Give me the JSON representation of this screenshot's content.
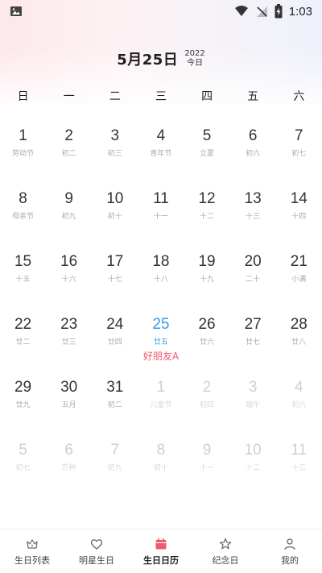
{
  "status_bar": {
    "time": "1:03"
  },
  "header": {
    "date": "5月25日",
    "year": "2022",
    "today_label": "今日"
  },
  "weekdays": [
    "日",
    "一",
    "二",
    "三",
    "四",
    "五",
    "六"
  ],
  "calendar": {
    "days": [
      {
        "num": "1",
        "lunar": "劳动节",
        "other": false
      },
      {
        "num": "2",
        "lunar": "初二",
        "other": false
      },
      {
        "num": "3",
        "lunar": "初三",
        "other": false
      },
      {
        "num": "4",
        "lunar": "青年节",
        "other": false
      },
      {
        "num": "5",
        "lunar": "立夏",
        "other": false
      },
      {
        "num": "6",
        "lunar": "初六",
        "other": false
      },
      {
        "num": "7",
        "lunar": "初七",
        "other": false
      },
      {
        "num": "8",
        "lunar": "母亲节",
        "other": false
      },
      {
        "num": "9",
        "lunar": "初九",
        "other": false
      },
      {
        "num": "10",
        "lunar": "初十",
        "other": false
      },
      {
        "num": "11",
        "lunar": "十一",
        "other": false
      },
      {
        "num": "12",
        "lunar": "十二",
        "other": false
      },
      {
        "num": "13",
        "lunar": "十三",
        "other": false
      },
      {
        "num": "14",
        "lunar": "十四",
        "other": false
      },
      {
        "num": "15",
        "lunar": "十五",
        "other": false
      },
      {
        "num": "16",
        "lunar": "十六",
        "other": false
      },
      {
        "num": "17",
        "lunar": "十七",
        "other": false
      },
      {
        "num": "18",
        "lunar": "十八",
        "other": false
      },
      {
        "num": "19",
        "lunar": "十九",
        "other": false
      },
      {
        "num": "20",
        "lunar": "二十",
        "other": false
      },
      {
        "num": "21",
        "lunar": "小满",
        "other": false
      },
      {
        "num": "22",
        "lunar": "廿二",
        "other": false
      },
      {
        "num": "23",
        "lunar": "廿三",
        "other": false
      },
      {
        "num": "24",
        "lunar": "廿四",
        "other": false
      },
      {
        "num": "25",
        "lunar": "廿五",
        "other": false,
        "today": true,
        "event": "好朋友A"
      },
      {
        "num": "26",
        "lunar": "廿六",
        "other": false
      },
      {
        "num": "27",
        "lunar": "廿七",
        "other": false
      },
      {
        "num": "28",
        "lunar": "廿八",
        "other": false
      },
      {
        "num": "29",
        "lunar": "廿九",
        "other": false
      },
      {
        "num": "30",
        "lunar": "五月",
        "other": false
      },
      {
        "num": "31",
        "lunar": "初二",
        "other": false
      },
      {
        "num": "1",
        "lunar": "儿童节",
        "other": true
      },
      {
        "num": "2",
        "lunar": "初四",
        "other": true
      },
      {
        "num": "3",
        "lunar": "端午",
        "other": true
      },
      {
        "num": "4",
        "lunar": "初六",
        "other": true
      },
      {
        "num": "5",
        "lunar": "初七",
        "other": true
      },
      {
        "num": "6",
        "lunar": "芒种",
        "other": true
      },
      {
        "num": "7",
        "lunar": "初九",
        "other": true
      },
      {
        "num": "8",
        "lunar": "初十",
        "other": true
      },
      {
        "num": "9",
        "lunar": "十一",
        "other": true
      },
      {
        "num": "10",
        "lunar": "十二",
        "other": true
      },
      {
        "num": "11",
        "lunar": "十三",
        "other": true
      }
    ]
  },
  "nav": {
    "items": [
      {
        "label": "生日列表",
        "icon": "crown-icon",
        "active": false
      },
      {
        "label": "明星生日",
        "icon": "heart-icon",
        "active": false
      },
      {
        "label": "生日日历",
        "icon": "calendar-icon",
        "active": true
      },
      {
        "label": "纪念日",
        "icon": "star-icon",
        "active": false
      },
      {
        "label": "我的",
        "icon": "person-icon",
        "active": false
      }
    ]
  },
  "colors": {
    "accent": "#f05a6e",
    "today": "#3a9be6"
  }
}
